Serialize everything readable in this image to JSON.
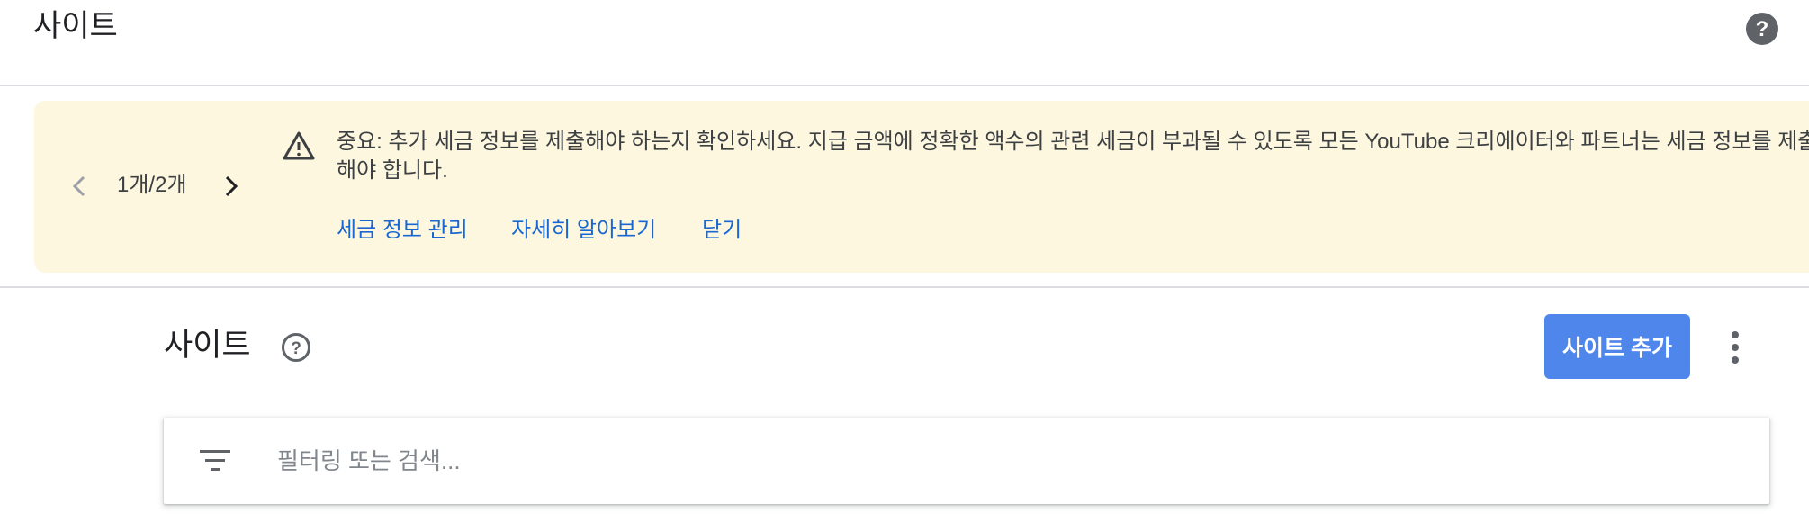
{
  "header": {
    "title": "사이트"
  },
  "banner": {
    "pager_text": "1개/2개",
    "message": "중요: 추가 세금 정보를 제출해야 하는지 확인하세요. 지급 금액에 정확한 액수의 관련 세금이 부과될 수 있도록 모든 YouTube 크리에이터와 파트너는 세금 정보를 제출해야 합니다.",
    "links": {
      "manage_tax": "세금 정보 관리",
      "learn_more": "자세히 알아보기",
      "close": "닫기"
    },
    "background_color": "#fef7e0"
  },
  "sites_section": {
    "title": "사이트",
    "add_button_label": "사이트 추가",
    "add_button_color": "#4f86ec"
  },
  "filter": {
    "placeholder": "필터링 또는 검색..."
  },
  "icons": {
    "help_header": "help-filled-icon",
    "warning": "warning-triangle-icon",
    "pager_prev": "chevron-left-icon",
    "pager_next": "chevron-right-icon",
    "help_section": "help-outline-icon",
    "more": "more-vert-icon",
    "filter": "filter-list-icon"
  }
}
